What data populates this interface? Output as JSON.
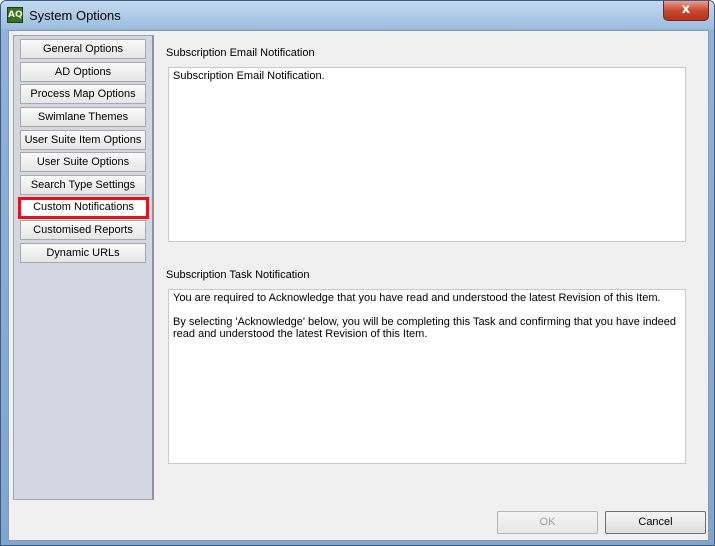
{
  "window": {
    "title": "System Options",
    "icon_text": "AQ",
    "close_label": "x"
  },
  "sidebar": {
    "items": [
      {
        "label": "General Options"
      },
      {
        "label": "AD Options"
      },
      {
        "label": "Process Map Options"
      },
      {
        "label": "Swimlane Themes"
      },
      {
        "label": "User Suite Item Options"
      },
      {
        "label": "User Suite Options"
      },
      {
        "label": "Search Type Settings"
      },
      {
        "label": "Custom Notifications",
        "selected": true
      },
      {
        "label": "Customised Reports"
      },
      {
        "label": "Dynamic URLs"
      }
    ]
  },
  "panel": {
    "email": {
      "label": "Subscription Email Notification",
      "value": "Subscription Email Notification."
    },
    "task": {
      "label": "Subscription Task Notification",
      "paragraph1": "You are required to Acknowledge that you have read and understood the latest Revision of this Item.",
      "paragraph2": "By selecting 'Acknowledge' below, you will be completing this Task and confirming that you have indeed read and understood the latest Revision of this Item."
    }
  },
  "footer": {
    "ok_label": "OK",
    "cancel_label": "Cancel"
  },
  "colors": {
    "highlight": "#e3121b",
    "sidebar_bg": "#d4d6e2"
  }
}
